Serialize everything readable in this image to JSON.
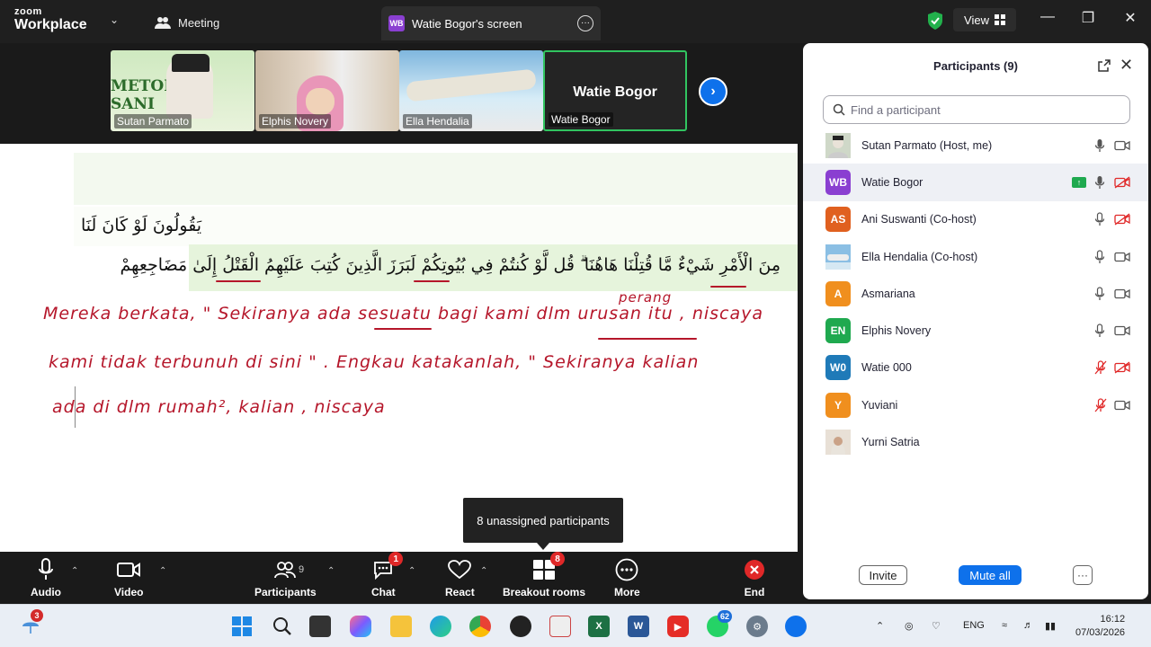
{
  "app": {
    "logo_top": "zoom",
    "logo_bottom": "Workplace",
    "meeting_label": "Meeting",
    "screen_tab_badge": "WB",
    "screen_tab_label": "Watie Bogor's screen",
    "view_label": "View"
  },
  "thumbnails": [
    {
      "name": "Sutan Parmato",
      "banner": "METODE ... SANI"
    },
    {
      "name": "Elphis Novery"
    },
    {
      "name": "Ella Hendalia"
    },
    {
      "name": "Watie Bogor",
      "big_name": "Watie Bogor"
    }
  ],
  "shared_screen": {
    "arabic_line1": "يَقُولُونَ لَوْ كَانَ لَنَا",
    "arabic_line2": "مِنَ الْأَمْرِ شَيْءٌ مَّا قُتِلْنَا هَاهُنَا ۗ قُل لَّوْ كُنتُمْ فِي بُيُوتِكُمْ لَبَرَزَ الَّذِينَ كُتِبَ عَلَيْهِمُ الْقَتْلُ إِلَىٰ مَضَاجِعِهِمْ",
    "handwriting": [
      "Mereka berkata, \" Sekiranya ada sesuatu bagi kami dlm urusan itu , niscaya",
      "perang",
      "kami tidak terbunuh di sini \" . Engkau katakanlah, \" Sekiranya kalian",
      "ada di dlm rumah², kalian , niscaya"
    ]
  },
  "tooltip": "8 unassigned participants",
  "toolbar": {
    "audio": "Audio",
    "video": "Video",
    "participants": "Participants",
    "participants_count": "9",
    "chat": "Chat",
    "chat_badge": "1",
    "react": "React",
    "breakout": "Breakout rooms",
    "breakout_badge": "8",
    "more": "More",
    "end": "End"
  },
  "panel": {
    "title": "Participants (9)",
    "search_placeholder": "Find a participant",
    "participants": [
      {
        "initials": "",
        "name": "Sutan Parmato (Host, me)",
        "color": "#9aa0a6",
        "mic": "on",
        "cam": "on",
        "photo": true
      },
      {
        "initials": "WB",
        "name": "Watie Bogor",
        "color": "#8a3fd1",
        "mic": "on",
        "cam": "off",
        "sharing": true
      },
      {
        "initials": "AS",
        "name": "Ani Suswanti (Co-host)",
        "color": "#e0601f",
        "mic": "on",
        "cam": "off"
      },
      {
        "initials": "",
        "name": "Ella Hendalia (Co-host)",
        "color": "#4a8fd0",
        "mic": "on",
        "cam": "on",
        "photo": true
      },
      {
        "initials": "A",
        "name": "Asmariana",
        "color": "#f08f1e",
        "mic": "on",
        "cam": "on"
      },
      {
        "initials": "EN",
        "name": "Elphis Novery",
        "color": "#1fa94f",
        "mic": "on",
        "cam": "on"
      },
      {
        "initials": "W0",
        "name": "Watie 000",
        "color": "#1f7ab8",
        "mic": "off",
        "cam": "off"
      },
      {
        "initials": "Y",
        "name": "Yuviani",
        "color": "#f08f1e",
        "mic": "off",
        "cam": "on"
      },
      {
        "initials": "",
        "name": "Yurni Satria",
        "color": "#c9a27e",
        "mic": "",
        "cam": "",
        "photo": true
      }
    ],
    "invite": "Invite",
    "mute_all": "Mute all",
    "more": "···"
  },
  "taskbar": {
    "weather_badge": "3",
    "whatsapp_badge": "62",
    "lang": "ENG",
    "time": "16:12",
    "date": "07/03/2026"
  }
}
